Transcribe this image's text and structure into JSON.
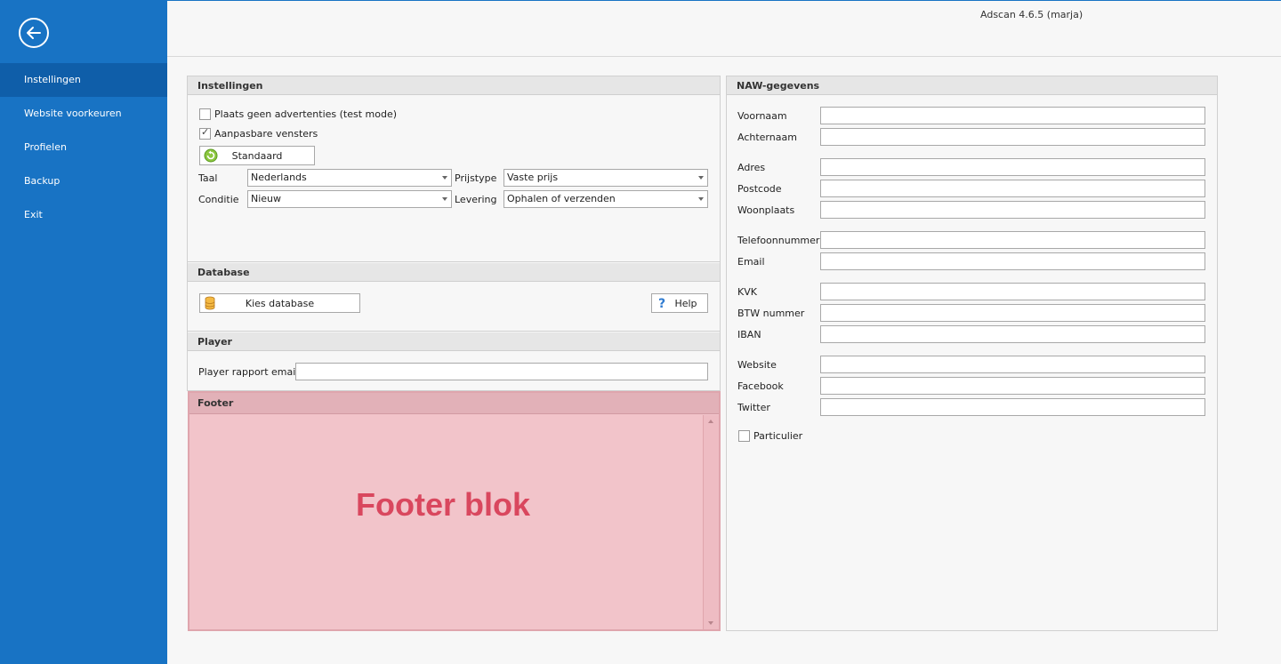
{
  "app": {
    "title": "Adscan 4.6.5 (marja)"
  },
  "colors": {
    "sidebar": "#1873c4",
    "sidebar_active": "#0f5ea9",
    "footer_bg": "#f2c4ca",
    "footer_text": "#d9475e"
  },
  "sidebar": {
    "back_icon": "arrow-left-icon",
    "items": [
      {
        "label": "Instellingen",
        "active": true
      },
      {
        "label": "Website voorkeuren",
        "active": false
      },
      {
        "label": "Profielen",
        "active": false
      },
      {
        "label": "Backup",
        "active": false
      },
      {
        "label": "Exit",
        "active": false
      }
    ]
  },
  "settings": {
    "header": "Instellingen",
    "test_mode_label": "Plaats geen advertenties (test mode)",
    "test_mode_checked": false,
    "custom_windows_label": "Aanpasbare vensters",
    "custom_windows_checked": true,
    "default_button": "Standaard",
    "language_label": "Taal",
    "language_value": "Nederlands",
    "price_type_label": "Prijstype",
    "price_type_value": "Vaste prijs",
    "condition_label": "Conditie",
    "condition_value": "Nieuw",
    "delivery_label": "Levering",
    "delivery_value": "Ophalen of verzenden"
  },
  "database": {
    "header": "Database",
    "choose_button": "Kies database",
    "help_button": "Help"
  },
  "player": {
    "header": "Player",
    "email_label": "Player rapport email",
    "email_value": ""
  },
  "footer": {
    "header": "Footer",
    "placeholder_text": "Footer blok"
  },
  "naw": {
    "header": "NAW-gegevens",
    "fields": [
      {
        "label": "Voornaam",
        "value": ""
      },
      {
        "label": "Achternaam",
        "value": ""
      },
      {
        "label": "Adres",
        "value": ""
      },
      {
        "label": "Postcode",
        "value": ""
      },
      {
        "label": "Woonplaats",
        "value": ""
      },
      {
        "label": "Telefoonnummer",
        "value": ""
      },
      {
        "label": "Email",
        "value": ""
      },
      {
        "label": "KVK",
        "value": ""
      },
      {
        "label": "BTW nummer",
        "value": ""
      },
      {
        "label": "IBAN",
        "value": ""
      },
      {
        "label": "Website",
        "value": ""
      },
      {
        "label": "Facebook",
        "value": ""
      },
      {
        "label": "Twitter",
        "value": ""
      }
    ],
    "private_label": "Particulier",
    "private_checked": false
  }
}
